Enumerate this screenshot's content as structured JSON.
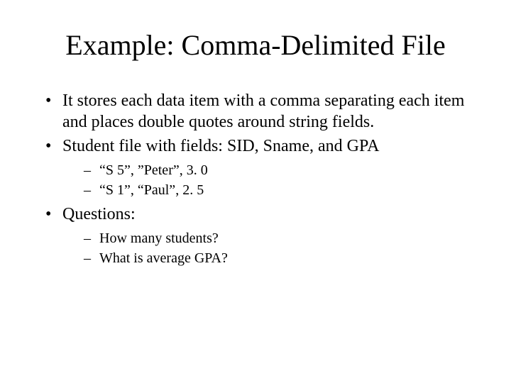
{
  "title": "Example: Comma-Delimited File",
  "bullets": {
    "b0": "It stores each data item with a comma separating each item and places double quotes around string fields.",
    "b1": "Student file with fields: SID, Sname, and GPA",
    "b1_sub": {
      "s0": "“S 5”, ”Peter”, 3. 0",
      "s1": "“S 1”, “Paul”, 2. 5"
    },
    "b2": "Questions:",
    "b2_sub": {
      "s0": "How many students?",
      "s1": "What is average GPA?"
    }
  }
}
